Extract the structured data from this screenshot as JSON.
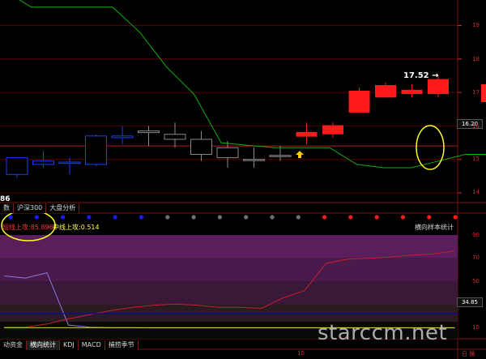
{
  "price_panel": {
    "y_axis_labels": [
      "19",
      "18",
      "17",
      "16",
      "15",
      "14"
    ],
    "current_price": "16.20",
    "high_label": "17.52",
    "left_number": "86",
    "candles": [
      {
        "o": 15.05,
        "c": 14.55,
        "h": 15.05,
        "l": 14.45,
        "dir": "down"
      },
      {
        "o": 14.85,
        "c": 14.95,
        "h": 15.25,
        "l": 14.75,
        "dir": "down"
      },
      {
        "o": 14.88,
        "c": 14.92,
        "h": 15.05,
        "l": 14.55,
        "dir": "down"
      },
      {
        "o": 14.85,
        "c": 15.7,
        "h": 15.75,
        "l": 14.8,
        "dir": "down"
      },
      {
        "o": 15.65,
        "c": 15.7,
        "h": 16.0,
        "l": 15.45,
        "dir": "down"
      },
      {
        "o": 15.8,
        "c": 15.85,
        "h": 16.0,
        "l": 15.4,
        "dir": "gray"
      },
      {
        "o": 15.75,
        "c": 15.6,
        "h": 16.1,
        "l": 15.35,
        "dir": "gray"
      },
      {
        "o": 15.6,
        "c": 15.15,
        "h": 15.85,
        "l": 14.95,
        "dir": "gray"
      },
      {
        "o": 15.35,
        "c": 15.05,
        "h": 15.55,
        "l": 14.75,
        "dir": "gray"
      },
      {
        "o": 15.0,
        "c": 14.98,
        "h": 15.35,
        "l": 14.75,
        "dir": "gray"
      },
      {
        "o": 15.1,
        "c": 15.12,
        "h": 15.4,
        "l": 14.95,
        "dir": "gray"
      },
      {
        "o": 15.68,
        "c": 15.82,
        "h": 16.1,
        "l": 15.45,
        "dir": "up"
      },
      {
        "o": 15.75,
        "c": 16.02,
        "h": 16.1,
        "l": 15.65,
        "dir": "up"
      },
      {
        "o": 16.4,
        "c": 17.05,
        "h": 17.15,
        "l": 16.4,
        "dir": "up"
      },
      {
        "o": 16.85,
        "c": 17.22,
        "h": 17.3,
        "l": 16.85,
        "dir": "up"
      },
      {
        "o": 16.95,
        "c": 17.08,
        "h": 17.25,
        "l": 16.85,
        "dir": "up"
      },
      {
        "o": 16.95,
        "c": 17.4,
        "h": 17.52,
        "l": 16.85,
        "dir": "up"
      }
    ],
    "green_line": [
      20.05,
      19.55,
      19.55,
      19.55,
      19.55,
      18.8,
      17.75,
      16.95,
      15.5,
      15.42,
      15.35,
      15.35,
      15.35,
      14.85,
      14.75,
      14.75,
      14.95,
      15.15,
      15.15,
      15.3,
      15.3,
      15.55
    ]
  },
  "top_tabs": [
    "数",
    "沪深300",
    "大盘分析"
  ],
  "signal_dots": [
    "blue",
    "blue",
    "blue",
    "blue",
    "blue",
    "blue",
    "gray",
    "gray",
    "gray",
    "gray",
    "gray",
    "gray",
    "red",
    "red",
    "red",
    "red",
    "red",
    "red"
  ],
  "indicator": {
    "label1": "短线上攻:85.896",
    "label2": "中线上攻:0.514",
    "name": "横向样本统计",
    "y_axis_labels": [
      "90",
      "70",
      "50",
      "10"
    ],
    "current_value": "34.85",
    "red_line": [
      1,
      1,
      4,
      9,
      13,
      17,
      20,
      22,
      23,
      22,
      20,
      20,
      19,
      29,
      36,
      62,
      66,
      67,
      68,
      70,
      71,
      74
    ],
    "purple_line": [
      50,
      48,
      53,
      3,
      1,
      0.5,
      0.5,
      0.3,
      0.3,
      0.3,
      0.3,
      0.3,
      0.3,
      0.3,
      0.3,
      0.3,
      0.3,
      0.3,
      0.3,
      0.3,
      0.3,
      0.3
    ],
    "yellow_line": [
      0.5,
      0.5,
      0.5,
      0.5,
      0.5,
      0.5,
      0.5,
      0.5,
      0.5,
      0.5,
      0.5,
      0.5,
      0.5,
      0.5,
      0.5,
      0.5,
      0.5,
      0.5,
      0.5,
      0.5,
      0.5,
      0.5
    ]
  },
  "bottom_tabs": [
    "动资金",
    "横向统计",
    "KDJ",
    "MACD",
    "捕捞季节"
  ],
  "x_axis": {
    "date": "10",
    "right": "日 横"
  },
  "watermark": "starccm.net",
  "colors": {
    "up": "#ff1a1a",
    "down": "#1a3cff",
    "ma": "#10b010",
    "red_line": "#c81e2c",
    "purple_line": "#8a78e0",
    "grid": "#5a0000"
  }
}
